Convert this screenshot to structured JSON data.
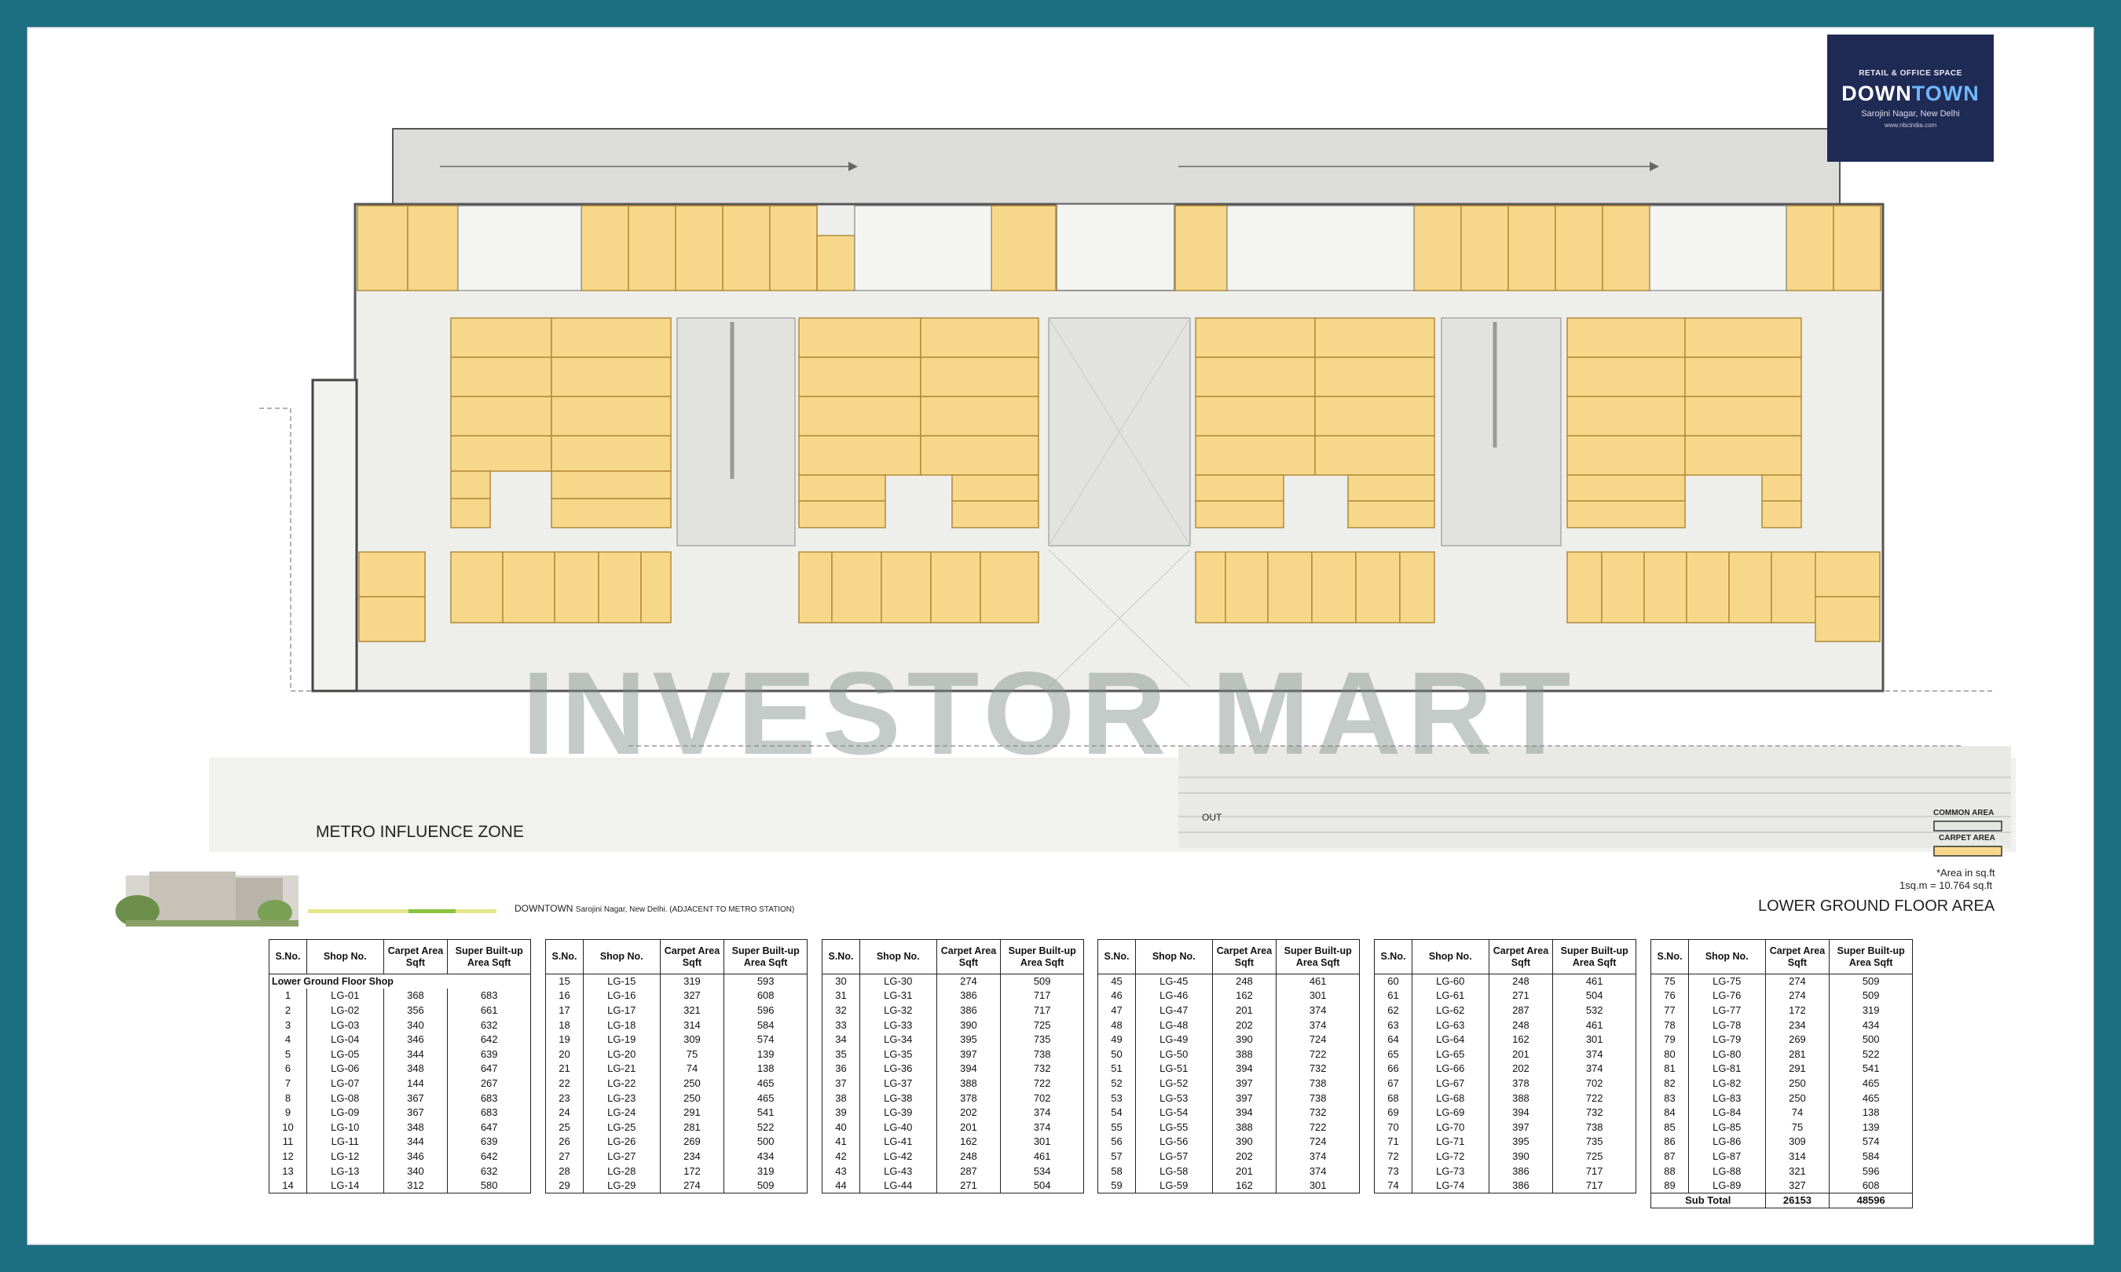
{
  "logo": {
    "tagline": "RETAIL & OFFICE SPACE",
    "brand_a": "DOWN",
    "brand_b": "TOWN",
    "location": "Sarojini Nagar, New Delhi",
    "website": "www.nbcindia.com"
  },
  "plan": {
    "watermark": "INVESTOR MART",
    "metro_zone_label": "METRO INFLUENCE ZONE",
    "out_label": "OUT",
    "footer_project": "DOWNTOWN",
    "footer_location": "Sarojini Nagar, New Delhi. (ADJACENT TO METRO STATION)",
    "floor_title": "LOWER GROUND FLOOR AREA",
    "units_note": "*Area in sq.ft",
    "conversion_note": "1sq.m = 10.764 sq.ft",
    "colors": {
      "carpet": "#f7d88a",
      "common": "#e4e6e0",
      "border": "#1b6f80"
    }
  },
  "legend": {
    "common_area": "COMMON AREA",
    "carpet_area": "CARPET AREA"
  },
  "table": {
    "headers": {
      "sno": "S.No.",
      "shop": "Shop No.",
      "carpet": "Carpet Area Sqft",
      "super": "Super Built-up Area Sqft"
    },
    "group_label": "Lower Ground Floor Shop",
    "subtotal_label": "Sub Total",
    "subtotal_carpet": "26153",
    "subtotal_super": "48596",
    "rows": [
      [
        "1",
        "LG-01",
        "368",
        "683"
      ],
      [
        "2",
        "LG-02",
        "356",
        "661"
      ],
      [
        "3",
        "LG-03",
        "340",
        "632"
      ],
      [
        "4",
        "LG-04",
        "346",
        "642"
      ],
      [
        "5",
        "LG-05",
        "344",
        "639"
      ],
      [
        "6",
        "LG-06",
        "348",
        "647"
      ],
      [
        "7",
        "LG-07",
        "144",
        "267"
      ],
      [
        "8",
        "LG-08",
        "367",
        "683"
      ],
      [
        "9",
        "LG-09",
        "367",
        "683"
      ],
      [
        "10",
        "LG-10",
        "348",
        "647"
      ],
      [
        "11",
        "LG-11",
        "344",
        "639"
      ],
      [
        "12",
        "LG-12",
        "346",
        "642"
      ],
      [
        "13",
        "LG-13",
        "340",
        "632"
      ],
      [
        "14",
        "LG-14",
        "312",
        "580"
      ],
      [
        "15",
        "LG-15",
        "319",
        "593"
      ],
      [
        "16",
        "LG-16",
        "327",
        "608"
      ],
      [
        "17",
        "LG-17",
        "321",
        "596"
      ],
      [
        "18",
        "LG-18",
        "314",
        "584"
      ],
      [
        "19",
        "LG-19",
        "309",
        "574"
      ],
      [
        "20",
        "LG-20",
        "75",
        "139"
      ],
      [
        "21",
        "LG-21",
        "74",
        "138"
      ],
      [
        "22",
        "LG-22",
        "250",
        "465"
      ],
      [
        "23",
        "LG-23",
        "250",
        "465"
      ],
      [
        "24",
        "LG-24",
        "291",
        "541"
      ],
      [
        "25",
        "LG-25",
        "281",
        "522"
      ],
      [
        "26",
        "LG-26",
        "269",
        "500"
      ],
      [
        "27",
        "LG-27",
        "234",
        "434"
      ],
      [
        "28",
        "LG-28",
        "172",
        "319"
      ],
      [
        "29",
        "LG-29",
        "274",
        "509"
      ],
      [
        "30",
        "LG-30",
        "274",
        "509"
      ],
      [
        "31",
        "LG-31",
        "386",
        "717"
      ],
      [
        "32",
        "LG-32",
        "386",
        "717"
      ],
      [
        "33",
        "LG-33",
        "390",
        "725"
      ],
      [
        "34",
        "LG-34",
        "395",
        "735"
      ],
      [
        "35",
        "LG-35",
        "397",
        "738"
      ],
      [
        "36",
        "LG-36",
        "394",
        "732"
      ],
      [
        "37",
        "LG-37",
        "388",
        "722"
      ],
      [
        "38",
        "LG-38",
        "378",
        "702"
      ],
      [
        "39",
        "LG-39",
        "202",
        "374"
      ],
      [
        "40",
        "LG-40",
        "201",
        "374"
      ],
      [
        "41",
        "LG-41",
        "162",
        "301"
      ],
      [
        "42",
        "LG-42",
        "248",
        "461"
      ],
      [
        "43",
        "LG-43",
        "287",
        "534"
      ],
      [
        "44",
        "LG-44",
        "271",
        "504"
      ],
      [
        "45",
        "LG-45",
        "248",
        "461"
      ],
      [
        "46",
        "LG-46",
        "162",
        "301"
      ],
      [
        "47",
        "LG-47",
        "201",
        "374"
      ],
      [
        "48",
        "LG-48",
        "202",
        "374"
      ],
      [
        "49",
        "LG-49",
        "390",
        "724"
      ],
      [
        "50",
        "LG-50",
        "388",
        "722"
      ],
      [
        "51",
        "LG-51",
        "394",
        "732"
      ],
      [
        "52",
        "LG-52",
        "397",
        "738"
      ],
      [
        "53",
        "LG-53",
        "397",
        "738"
      ],
      [
        "54",
        "LG-54",
        "394",
        "732"
      ],
      [
        "55",
        "LG-55",
        "388",
        "722"
      ],
      [
        "56",
        "LG-56",
        "390",
        "724"
      ],
      [
        "57",
        "LG-57",
        "202",
        "374"
      ],
      [
        "58",
        "LG-58",
        "201",
        "374"
      ],
      [
        "59",
        "LG-59",
        "162",
        "301"
      ],
      [
        "60",
        "LG-60",
        "248",
        "461"
      ],
      [
        "61",
        "LG-61",
        "271",
        "504"
      ],
      [
        "62",
        "LG-62",
        "287",
        "532"
      ],
      [
        "63",
        "LG-63",
        "248",
        "461"
      ],
      [
        "64",
        "LG-64",
        "162",
        "301"
      ],
      [
        "65",
        "LG-65",
        "201",
        "374"
      ],
      [
        "66",
        "LG-66",
        "202",
        "374"
      ],
      [
        "67",
        "LG-67",
        "378",
        "702"
      ],
      [
        "68",
        "LG-68",
        "388",
        "722"
      ],
      [
        "69",
        "LG-69",
        "394",
        "732"
      ],
      [
        "70",
        "LG-70",
        "397",
        "738"
      ],
      [
        "71",
        "LG-71",
        "395",
        "735"
      ],
      [
        "72",
        "LG-72",
        "390",
        "725"
      ],
      [
        "73",
        "LG-73",
        "386",
        "717"
      ],
      [
        "74",
        "LG-74",
        "386",
        "717"
      ],
      [
        "75",
        "LG-75",
        "274",
        "509"
      ],
      [
        "76",
        "LG-76",
        "274",
        "509"
      ],
      [
        "77",
        "LG-77",
        "172",
        "319"
      ],
      [
        "78",
        "LG-78",
        "234",
        "434"
      ],
      [
        "79",
        "LG-79",
        "269",
        "500"
      ],
      [
        "80",
        "LG-80",
        "281",
        "522"
      ],
      [
        "81",
        "LG-81",
        "291",
        "541"
      ],
      [
        "82",
        "LG-82",
        "250",
        "465"
      ],
      [
        "83",
        "LG-83",
        "250",
        "465"
      ],
      [
        "84",
        "LG-84",
        "74",
        "138"
      ],
      [
        "85",
        "LG-85",
        "75",
        "139"
      ],
      [
        "86",
        "LG-86",
        "309",
        "574"
      ],
      [
        "87",
        "LG-87",
        "314",
        "584"
      ],
      [
        "88",
        "LG-88",
        "321",
        "596"
      ],
      [
        "89",
        "LG-89",
        "327",
        "608"
      ]
    ]
  }
}
